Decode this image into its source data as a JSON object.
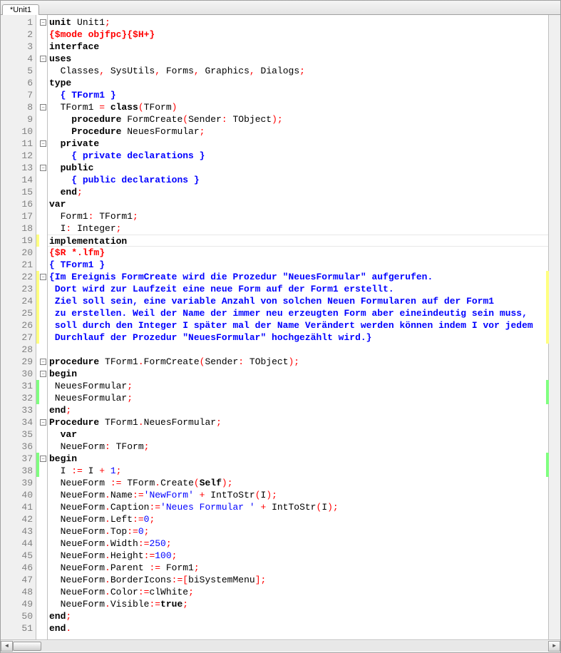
{
  "tab_title": "*Unit1",
  "lines": [
    {
      "n": 1,
      "fold": "box",
      "chg": "",
      "tokens": [
        {
          "t": "unit ",
          "c": "c-kw"
        },
        {
          "t": "Unit1",
          "c": "c-plain"
        },
        {
          "t": ";",
          "c": "c-sym"
        }
      ]
    },
    {
      "n": 2,
      "fold": "",
      "chg": "",
      "tokens": [
        {
          "t": "{$mode objfpc}{$H+}",
          "c": "c-dir"
        }
      ]
    },
    {
      "n": 3,
      "fold": "",
      "chg": "",
      "tokens": [
        {
          "t": "interface",
          "c": "c-kw"
        }
      ]
    },
    {
      "n": 4,
      "fold": "box",
      "chg": "",
      "tokens": [
        {
          "t": "uses",
          "c": "c-kw"
        }
      ]
    },
    {
      "n": 5,
      "fold": "",
      "chg": "",
      "tokens": [
        {
          "t": "  Classes",
          "c": "c-plain"
        },
        {
          "t": ", ",
          "c": "c-sym"
        },
        {
          "t": "SysUtils",
          "c": "c-plain"
        },
        {
          "t": ", ",
          "c": "c-sym"
        },
        {
          "t": "Forms",
          "c": "c-plain"
        },
        {
          "t": ", ",
          "c": "c-sym"
        },
        {
          "t": "Graphics",
          "c": "c-plain"
        },
        {
          "t": ", ",
          "c": "c-sym"
        },
        {
          "t": "Dialogs",
          "c": "c-plain"
        },
        {
          "t": ";",
          "c": "c-sym"
        }
      ]
    },
    {
      "n": 6,
      "fold": "",
      "chg": "",
      "tokens": [
        {
          "t": "type",
          "c": "c-kw"
        }
      ]
    },
    {
      "n": 7,
      "fold": "",
      "chg": "",
      "tokens": [
        {
          "t": "  ",
          "c": ""
        },
        {
          "t": "{ TForm1 }",
          "c": "c-com"
        }
      ]
    },
    {
      "n": 8,
      "fold": "box",
      "chg": "",
      "tokens": [
        {
          "t": "  TForm1 ",
          "c": "c-plain"
        },
        {
          "t": "= ",
          "c": "c-sym"
        },
        {
          "t": "class",
          "c": "c-kw"
        },
        {
          "t": "(",
          "c": "c-sym"
        },
        {
          "t": "TForm",
          "c": "c-plain"
        },
        {
          "t": ")",
          "c": "c-sym"
        }
      ]
    },
    {
      "n": 9,
      "fold": "",
      "chg": "",
      "tokens": [
        {
          "t": "    ",
          "c": ""
        },
        {
          "t": "procedure ",
          "c": "c-kw"
        },
        {
          "t": "FormCreate",
          "c": "c-plain"
        },
        {
          "t": "(",
          "c": "c-sym"
        },
        {
          "t": "Sender",
          "c": "c-plain"
        },
        {
          "t": ": ",
          "c": "c-sym"
        },
        {
          "t": "TObject",
          "c": "c-plain"
        },
        {
          "t": ");",
          "c": "c-sym"
        }
      ]
    },
    {
      "n": 10,
      "fold": "",
      "chg": "",
      "tokens": [
        {
          "t": "    ",
          "c": ""
        },
        {
          "t": "Procedure ",
          "c": "c-kw"
        },
        {
          "t": "NeuesFormular",
          "c": "c-plain"
        },
        {
          "t": ";",
          "c": "c-sym"
        }
      ]
    },
    {
      "n": 11,
      "fold": "box",
      "chg": "",
      "tokens": [
        {
          "t": "  ",
          "c": ""
        },
        {
          "t": "private",
          "c": "c-kw"
        }
      ]
    },
    {
      "n": 12,
      "fold": "",
      "chg": "",
      "tokens": [
        {
          "t": "    ",
          "c": ""
        },
        {
          "t": "{ private declarations }",
          "c": "c-com"
        }
      ]
    },
    {
      "n": 13,
      "fold": "box",
      "chg": "",
      "tokens": [
        {
          "t": "  ",
          "c": ""
        },
        {
          "t": "public",
          "c": "c-kw"
        }
      ]
    },
    {
      "n": 14,
      "fold": "",
      "chg": "",
      "tokens": [
        {
          "t": "    ",
          "c": ""
        },
        {
          "t": "{ public declarations }",
          "c": "c-com"
        }
      ]
    },
    {
      "n": 15,
      "fold": "",
      "chg": "",
      "tokens": [
        {
          "t": "  ",
          "c": ""
        },
        {
          "t": "end",
          "c": "c-kw"
        },
        {
          "t": ";",
          "c": "c-sym"
        }
      ]
    },
    {
      "n": 16,
      "fold": "",
      "chg": "",
      "tokens": [
        {
          "t": "var",
          "c": "c-kw"
        }
      ]
    },
    {
      "n": 17,
      "fold": "",
      "chg": "",
      "tokens": [
        {
          "t": "  Form1",
          "c": "c-plain"
        },
        {
          "t": ": ",
          "c": "c-sym"
        },
        {
          "t": "TForm1",
          "c": "c-plain"
        },
        {
          "t": ";",
          "c": "c-sym"
        }
      ]
    },
    {
      "n": 18,
      "fold": "",
      "chg": "",
      "tokens": [
        {
          "t": "  I",
          "c": "c-plain"
        },
        {
          "t": ": ",
          "c": "c-sym"
        },
        {
          "t": "Integer",
          "c": "c-plain"
        },
        {
          "t": ";",
          "c": "c-sym"
        }
      ]
    },
    {
      "n": 19,
      "fold": "",
      "chg": "yellow",
      "current": true,
      "tokens": [
        {
          "t": "implementation",
          "c": "c-kw"
        }
      ]
    },
    {
      "n": 20,
      "fold": "",
      "chg": "",
      "tokens": [
        {
          "t": "{$R *.lfm}",
          "c": "c-dir"
        }
      ]
    },
    {
      "n": 21,
      "fold": "",
      "chg": "",
      "tokens": [
        {
          "t": "{ TForm1 }",
          "c": "c-com"
        }
      ]
    },
    {
      "n": 22,
      "fold": "box",
      "chg": "yellow",
      "rchg": "yellow",
      "tokens": [
        {
          "t": "{Im Ereignis FormCreate wird die Prozedur \"NeuesFormular\" aufgerufen.",
          "c": "c-com"
        }
      ]
    },
    {
      "n": 23,
      "fold": "",
      "chg": "yellow",
      "rchg": "yellow",
      "tokens": [
        {
          "t": " Dort wird zur Laufzeit eine neue Form auf der Form1 erstellt.",
          "c": "c-com"
        }
      ]
    },
    {
      "n": 24,
      "fold": "",
      "chg": "yellow",
      "rchg": "yellow",
      "tokens": [
        {
          "t": " Ziel soll sein, eine variable Anzahl von solchen Neuen Formularen auf der Form1",
          "c": "c-com"
        }
      ]
    },
    {
      "n": 25,
      "fold": "",
      "chg": "yellow",
      "rchg": "yellow",
      "tokens": [
        {
          "t": " zu erstellen. Weil der Name der immer neu erzeugten Form aber eineindeutig sein muss,",
          "c": "c-com"
        }
      ]
    },
    {
      "n": 26,
      "fold": "",
      "chg": "yellow",
      "rchg": "yellow",
      "tokens": [
        {
          "t": " soll durch den Integer I später mal der Name Verändert werden können indem I vor jedem",
          "c": "c-com"
        }
      ]
    },
    {
      "n": 27,
      "fold": "",
      "chg": "yellow",
      "rchg": "yellow",
      "tokens": [
        {
          "t": " Durchlauf der Prozedur \"NeuesFormular\" hochgezählt wird.}",
          "c": "c-com"
        }
      ]
    },
    {
      "n": 28,
      "fold": "",
      "chg": "",
      "tokens": []
    },
    {
      "n": 29,
      "fold": "box",
      "chg": "",
      "tokens": [
        {
          "t": "procedure ",
          "c": "c-kw"
        },
        {
          "t": "TForm1",
          "c": "c-plain"
        },
        {
          "t": ".",
          "c": "c-sym"
        },
        {
          "t": "FormCreate",
          "c": "c-plain"
        },
        {
          "t": "(",
          "c": "c-sym"
        },
        {
          "t": "Sender",
          "c": "c-plain"
        },
        {
          "t": ": ",
          "c": "c-sym"
        },
        {
          "t": "TObject",
          "c": "c-plain"
        },
        {
          "t": ");",
          "c": "c-sym"
        }
      ]
    },
    {
      "n": 30,
      "fold": "box",
      "chg": "",
      "tokens": [
        {
          "t": "begin",
          "c": "c-kw"
        }
      ]
    },
    {
      "n": 31,
      "fold": "",
      "chg": "green",
      "rchg": "green",
      "tokens": [
        {
          "t": " NeuesFormular",
          "c": "c-plain"
        },
        {
          "t": ";",
          "c": "c-sym"
        }
      ]
    },
    {
      "n": 32,
      "fold": "",
      "chg": "green",
      "rchg": "green",
      "tokens": [
        {
          "t": " NeuesFormular",
          "c": "c-plain"
        },
        {
          "t": ";",
          "c": "c-sym"
        }
      ]
    },
    {
      "n": 33,
      "fold": "",
      "chg": "",
      "tokens": [
        {
          "t": "end",
          "c": "c-kw"
        },
        {
          "t": ";",
          "c": "c-sym"
        }
      ]
    },
    {
      "n": 34,
      "fold": "box",
      "chg": "",
      "tokens": [
        {
          "t": "Procedure ",
          "c": "c-kw"
        },
        {
          "t": "TForm1",
          "c": "c-plain"
        },
        {
          "t": ".",
          "c": "c-sym"
        },
        {
          "t": "NeuesFormular",
          "c": "c-plain"
        },
        {
          "t": ";",
          "c": "c-sym"
        }
      ]
    },
    {
      "n": 35,
      "fold": "",
      "chg": "",
      "tokens": [
        {
          "t": "  ",
          "c": ""
        },
        {
          "t": "var",
          "c": "c-kw"
        }
      ]
    },
    {
      "n": 36,
      "fold": "",
      "chg": "",
      "tokens": [
        {
          "t": "  NeueForm",
          "c": "c-plain"
        },
        {
          "t": ": ",
          "c": "c-sym"
        },
        {
          "t": "TForm",
          "c": "c-plain"
        },
        {
          "t": ";",
          "c": "c-sym"
        }
      ]
    },
    {
      "n": 37,
      "fold": "box",
      "chg": "green",
      "rchg": "green",
      "tokens": [
        {
          "t": "begin",
          "c": "c-kw"
        }
      ]
    },
    {
      "n": 38,
      "fold": "",
      "chg": "green",
      "rchg": "green",
      "tokens": [
        {
          "t": "  I ",
          "c": "c-plain"
        },
        {
          "t": ":= ",
          "c": "c-sym"
        },
        {
          "t": "I ",
          "c": "c-plain"
        },
        {
          "t": "+ ",
          "c": "c-sym"
        },
        {
          "t": "1",
          "c": "c-num"
        },
        {
          "t": ";",
          "c": "c-sym"
        }
      ]
    },
    {
      "n": 39,
      "fold": "",
      "chg": "",
      "tokens": [
        {
          "t": "  NeueForm ",
          "c": "c-plain"
        },
        {
          "t": ":= ",
          "c": "c-sym"
        },
        {
          "t": "TForm",
          "c": "c-plain"
        },
        {
          "t": ".",
          "c": "c-sym"
        },
        {
          "t": "Create",
          "c": "c-plain"
        },
        {
          "t": "(",
          "c": "c-sym"
        },
        {
          "t": "Self",
          "c": "c-kw"
        },
        {
          "t": ");",
          "c": "c-sym"
        }
      ]
    },
    {
      "n": 40,
      "fold": "",
      "chg": "",
      "tokens": [
        {
          "t": "  NeueForm",
          "c": "c-plain"
        },
        {
          "t": ".",
          "c": "c-sym"
        },
        {
          "t": "Name",
          "c": "c-plain"
        },
        {
          "t": ":=",
          "c": "c-sym"
        },
        {
          "t": "'NewForm'",
          "c": "c-str"
        },
        {
          "t": " + ",
          "c": "c-sym"
        },
        {
          "t": "IntToStr",
          "c": "c-plain"
        },
        {
          "t": "(",
          "c": "c-sym"
        },
        {
          "t": "I",
          "c": "c-plain"
        },
        {
          "t": ");",
          "c": "c-sym"
        }
      ]
    },
    {
      "n": 41,
      "fold": "",
      "chg": "",
      "tokens": [
        {
          "t": "  NeueForm",
          "c": "c-plain"
        },
        {
          "t": ".",
          "c": "c-sym"
        },
        {
          "t": "Caption",
          "c": "c-plain"
        },
        {
          "t": ":=",
          "c": "c-sym"
        },
        {
          "t": "'Neues Formular '",
          "c": "c-str"
        },
        {
          "t": " + ",
          "c": "c-sym"
        },
        {
          "t": "IntToStr",
          "c": "c-plain"
        },
        {
          "t": "(",
          "c": "c-sym"
        },
        {
          "t": "I",
          "c": "c-plain"
        },
        {
          "t": ");",
          "c": "c-sym"
        }
      ]
    },
    {
      "n": 42,
      "fold": "",
      "chg": "",
      "tokens": [
        {
          "t": "  NeueForm",
          "c": "c-plain"
        },
        {
          "t": ".",
          "c": "c-sym"
        },
        {
          "t": "Left",
          "c": "c-plain"
        },
        {
          "t": ":=",
          "c": "c-sym"
        },
        {
          "t": "0",
          "c": "c-num"
        },
        {
          "t": ";",
          "c": "c-sym"
        }
      ]
    },
    {
      "n": 43,
      "fold": "",
      "chg": "",
      "tokens": [
        {
          "t": "  NeueForm",
          "c": "c-plain"
        },
        {
          "t": ".",
          "c": "c-sym"
        },
        {
          "t": "Top",
          "c": "c-plain"
        },
        {
          "t": ":=",
          "c": "c-sym"
        },
        {
          "t": "0",
          "c": "c-num"
        },
        {
          "t": ";",
          "c": "c-sym"
        }
      ]
    },
    {
      "n": 44,
      "fold": "",
      "chg": "",
      "tokens": [
        {
          "t": "  NeueForm",
          "c": "c-plain"
        },
        {
          "t": ".",
          "c": "c-sym"
        },
        {
          "t": "Width",
          "c": "c-plain"
        },
        {
          "t": ":=",
          "c": "c-sym"
        },
        {
          "t": "250",
          "c": "c-num"
        },
        {
          "t": ";",
          "c": "c-sym"
        }
      ]
    },
    {
      "n": 45,
      "fold": "",
      "chg": "",
      "tokens": [
        {
          "t": "  NeueForm",
          "c": "c-plain"
        },
        {
          "t": ".",
          "c": "c-sym"
        },
        {
          "t": "Height",
          "c": "c-plain"
        },
        {
          "t": ":=",
          "c": "c-sym"
        },
        {
          "t": "100",
          "c": "c-num"
        },
        {
          "t": ";",
          "c": "c-sym"
        }
      ]
    },
    {
      "n": 46,
      "fold": "",
      "chg": "",
      "tokens": [
        {
          "t": "  NeueForm",
          "c": "c-plain"
        },
        {
          "t": ".",
          "c": "c-sym"
        },
        {
          "t": "Parent ",
          "c": "c-plain"
        },
        {
          "t": ":= ",
          "c": "c-sym"
        },
        {
          "t": "Form1",
          "c": "c-plain"
        },
        {
          "t": ";",
          "c": "c-sym"
        }
      ]
    },
    {
      "n": 47,
      "fold": "",
      "chg": "",
      "tokens": [
        {
          "t": "  NeueForm",
          "c": "c-plain"
        },
        {
          "t": ".",
          "c": "c-sym"
        },
        {
          "t": "BorderIcons",
          "c": "c-plain"
        },
        {
          "t": ":=[",
          "c": "c-sym"
        },
        {
          "t": "biSystemMenu",
          "c": "c-plain"
        },
        {
          "t": "];",
          "c": "c-sym"
        }
      ]
    },
    {
      "n": 48,
      "fold": "",
      "chg": "",
      "tokens": [
        {
          "t": "  NeueForm",
          "c": "c-plain"
        },
        {
          "t": ".",
          "c": "c-sym"
        },
        {
          "t": "Color",
          "c": "c-plain"
        },
        {
          "t": ":=",
          "c": "c-sym"
        },
        {
          "t": "clWhite",
          "c": "c-plain"
        },
        {
          "t": ";",
          "c": "c-sym"
        }
      ]
    },
    {
      "n": 49,
      "fold": "",
      "chg": "",
      "tokens": [
        {
          "t": "  NeueForm",
          "c": "c-plain"
        },
        {
          "t": ".",
          "c": "c-sym"
        },
        {
          "t": "Visible",
          "c": "c-plain"
        },
        {
          "t": ":=",
          "c": "c-sym"
        },
        {
          "t": "true",
          "c": "c-kw"
        },
        {
          "t": ";",
          "c": "c-sym"
        }
      ]
    },
    {
      "n": 50,
      "fold": "",
      "chg": "",
      "tokens": [
        {
          "t": "end",
          "c": "c-kw"
        },
        {
          "t": ";",
          "c": "c-sym"
        }
      ]
    },
    {
      "n": 51,
      "fold": "",
      "chg": "",
      "tokens": [
        {
          "t": "end",
          "c": "c-kw"
        },
        {
          "t": ".",
          "c": "c-sym"
        }
      ]
    }
  ]
}
